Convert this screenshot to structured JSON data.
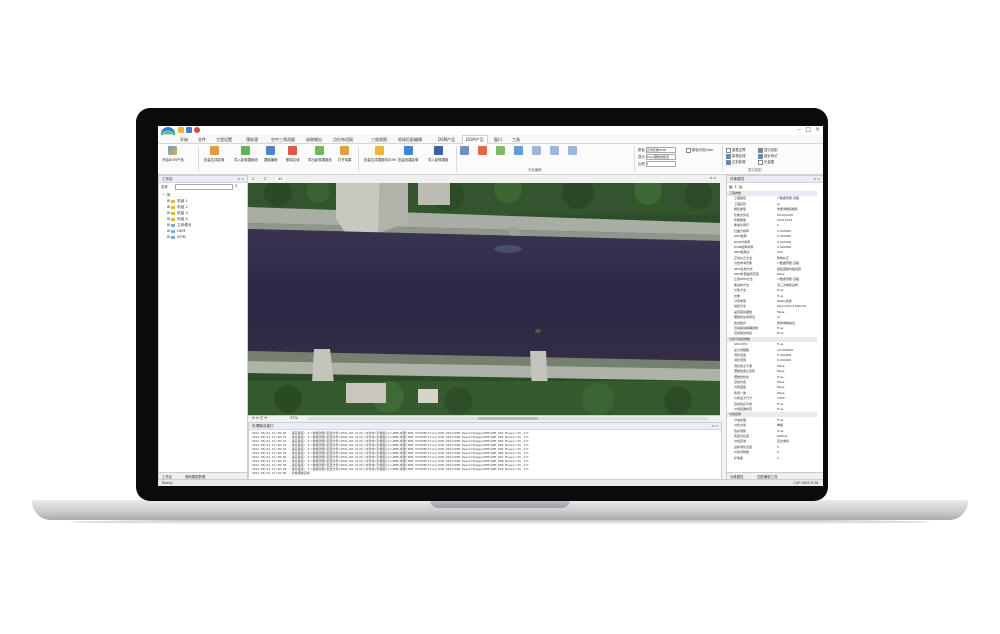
{
  "app": {
    "menu": [
      "开始",
      "文件",
      "工程设置",
      "预处理",
      "空中三角测量",
      "成果输出",
      "点位布设报",
      "三维视图",
      "地球匹配编辑",
      "DSM产品",
      "DOM产品",
      "窗口",
      "工具"
    ],
    "active_menu": "DOM产品"
  },
  "ribbon": {
    "buttons": [
      "开始DOM产品",
      "批量生成影像",
      "导入影像镶嵌线",
      "镶嵌编辑",
      "删除区域",
      "导出影像镶嵌线",
      "打开成果",
      "批量生成镶嵌线DOM",
      "批量创建影像",
      "导入影像镶嵌",
      "",
      "",
      "",
      "",
      "",
      "",
      ""
    ],
    "group_label": "匀色编辑",
    "group_label2": "显示控制",
    "options": {
      "color_label": "颜色",
      "color_value": "正射影像DOM",
      "blend_label": "显示",
      "blend_value": "Tiled镶嵌线配置",
      "scale_label": "比例",
      "scale_value": "1",
      "checks": [
        "颜色匀色Sdm",
        "显示控制",
        "重叠边界",
        "影像区域",
        "指针标记",
        "正射影像",
        "矢量图"
      ]
    },
    "check_states": [
      false,
      false,
      true,
      true,
      true,
      true,
      false
    ]
  },
  "project_panel": {
    "title": "工作区",
    "search_label": "名称",
    "tree": [
      "一 测",
      "机组 1",
      "机组 2",
      "机组 3",
      "机组 4",
      "立体像对",
      "DEM",
      "DOM"
    ],
    "tabs": [
      "工作区",
      "倾斜模型数据"
    ]
  },
  "map": {
    "tabs": [
      "1",
      "2",
      "40"
    ],
    "zoom": "37%"
  },
  "log": {
    "title": "处理输出窗口",
    "lines": [
      "2021-08-01 13:38:40 - 保存路径: I:\\数据测量\\配置文件\\2021-08-21(0)\\文件夹\\影像图(1)\\DOM\\成果\\DOM_V3\\DOM\\Tiled_DOM_2021\\DOM_ResultImage\\DOM\\DOM_001_Mosaic(0).tif",
      "2021-08-01 13:38:41 - 保存路径: I:\\数据测量\\配置文件\\2021-08-21(0)\\文件夹\\影像图(1)\\DOM\\成果\\DOM_V3\\DOM\\Tiled_DOM_2021\\DOM_ResultImage\\DOM\\DOM_002_Mosaic(0).tif",
      "2021-08-01 13:38:42 - 保存路径: I:\\数据测量\\配置文件\\2021-08-21(0)\\文件夹\\影像图(1)\\DOM\\成果\\DOM_V3\\DOM\\Tiled_DOM_2021\\DOM_ResultImage\\DOM\\DOM_003_Mosaic(0).tif",
      "2021-08-01 13:38:43 - 保存路径: I:\\数据测量\\配置文件\\2021-08-21(0)\\文件夹\\影像图(1)\\DOM\\成果\\DOM_V3\\DOM\\Tiled_DOM_2021\\DOM_ResultImage\\DOM\\DOM_004_Mosaic(0).tif",
      "2021-08-01 13:38:44 - 保存路径: I:\\数据测量\\配置文件\\2021-08-21(0)\\文件夹\\影像图(1)\\DOM\\成果\\DOM_V3\\DOM\\Tiled_DOM_2021\\DOM_ResultImage\\DOM\\DOM_005_Mosaic(0).tif",
      "2021-08-01 13:38:45 - 保存路径: I:\\数据测量\\配置文件\\2021-08-21(0)\\文件夹\\影像图(1)\\DOM\\成果\\DOM_V3\\DOM\\Tiled_DOM_2021\\DOM_ResultImage\\DOM\\DOM_006_Mosaic(0).tif",
      "2021-08-01 13:38:46 - 保存路径: I:\\数据测量\\配置文件\\2021-08-21(0)\\文件夹\\影像图(1)\\DOM\\成果\\DOM_V3\\DOM\\Tiled_DOM_2021\\DOM_ResultImage\\DOM\\DOM_007_Mosaic(0).tif",
      "2021-08-01 13:38:47 - 保存路径: I:\\数据测量\\配置文件\\2021-08-21(0)\\文件夹\\影像图(1)\\DOM\\成果\\DOM_V3\\DOM\\Tiled_DOM_2021\\DOM_ResultImage\\DOM\\DOM_008_Mosaic(0).tif",
      "2021-08-01 13:38:48 - 保存路径: I:\\数据测量\\配置文件\\2021-08-21(0)\\文件夹\\影像图(1)\\DOM\\成果\\DOM_V3\\DOM\\Tiled_DOM_2021\\DOM_ResultImage\\DOM\\DOM_009_Mosaic(0).tif",
      "2021-08-01 13:38:49 - 保存路径: I:\\数据测量\\配置文件\\2021-08-21(0)\\文件夹\\影像图(1)\\DOM\\成果\\DOM_V3\\DOM\\Tiled_DOM_2021\\DOM_ResultImage\\DOM\\DOM_010_Mosaic(0).tif",
      "2021-08-01 13:38:50 - 影像镶嵌完成"
    ]
  },
  "properties": {
    "title": "对象属性",
    "rows": [
      [
        "cat",
        "工程参数",
        ""
      ],
      [
        "row",
        "工程路径",
        "I:\\数据测量-远程"
      ],
      [
        "row",
        "工程名称",
        "ql"
      ],
      [
        "row",
        "相机类型",
        "非量测数码相机"
      ],
      [
        "row",
        "影像文件名",
        "DSC02000"
      ],
      [
        "row",
        "影像数量",
        "20211002"
      ],
      [
        "row",
        "像素比例尺",
        "0"
      ],
      [
        "row",
        "扫描分辨率",
        "0.003600"
      ],
      [
        "row",
        "DEM格网",
        "0.040000"
      ],
      [
        "row",
        "DOM分辨率",
        "0.040000"
      ],
      [
        "row",
        "DOM格网间隔",
        "0.040000"
      ],
      [
        "row",
        "DEM格网点",
        "200"
      ],
      [
        "row",
        "正射纠正方法",
        "整体纠正"
      ],
      [
        "row",
        "匀色参考影像",
        "I:\\数据测量-远程"
      ],
      [
        "row",
        "DEM生成方式",
        "加权函数内插运算"
      ],
      [
        "row",
        "DEM外部插值范围",
        "False"
      ],
      [
        "row",
        "正射DEM方法",
        "I:\\数据测量-远程"
      ],
      [
        "row",
        "重采样方法",
        "双三次卷积采样"
      ],
      [
        "row",
        "匀色方法",
        "True"
      ],
      [
        "row",
        "拉伸",
        "True"
      ],
      [
        "row",
        "分带类型",
        "Wallis滤波"
      ],
      [
        "row",
        "拼接方法",
        "Stand Point Method"
      ],
      [
        "row",
        "是否裁剪图幅",
        "False"
      ],
      [
        "row",
        "镶嵌线生成算法",
        "ql"
      ],
      [
        "row",
        "输出格式",
        "整体单独输出"
      ],
      [
        "row",
        "自动裁剪精确控制",
        "True"
      ],
      [
        "row",
        "自动裁剪拼接",
        "True"
      ],
      [
        "cat",
        "匀色与拼接参数",
        ""
      ],
      [
        "row",
        "GPU/CPU",
        "True"
      ],
      [
        "row",
        "最大线程数",
        "10.000000"
      ],
      [
        "row",
        "羽化宽度",
        "0.000000"
      ],
      [
        "row",
        "羽化范围",
        "0.000000"
      ],
      [
        "row",
        "羽化拐点平滑",
        "False"
      ],
      [
        "row",
        "镶嵌线避让建筑",
        "False"
      ],
      [
        "row",
        "镶嵌线优化",
        "True"
      ],
      [
        "row",
        "自动匀色",
        "False"
      ],
      [
        "row",
        "匀色强度",
        "False"
      ],
      [
        "row",
        "色调一致",
        "False"
      ],
      [
        "row",
        "匀色最大尺寸",
        "2400"
      ],
      [
        "row",
        "自动色彩平衡",
        "True"
      ],
      [
        "row",
        "匀色结果检查",
        "True"
      ],
      [
        "cat",
        "匀色控制",
        ""
      ],
      [
        "row",
        "分块处理",
        "True"
      ],
      [
        "row",
        "匀色方案",
        "单幅"
      ],
      [
        "row",
        "色彩调整",
        "True"
      ],
      [
        "row",
        "亮度对比度",
        "RADIAL"
      ],
      [
        "row",
        "匀色区域",
        "完全重叠"
      ],
      [
        "row",
        "边缘羽化宽度",
        "1"
      ],
      [
        "row",
        "匀色调整数",
        "0"
      ],
      [
        "row",
        "标准差",
        "0"
      ]
    ],
    "tabs": [
      "对象属性",
      "匹配编辑工具"
    ]
  },
  "statusbar": {
    "left": "Ready",
    "right": "CAP NUM SCRL"
  },
  "colors": {
    "water": "#312c4a",
    "grass": "#2f5a2a",
    "ribbon_bg": "#fbfbfb",
    "panel_header": "#e9eef5",
    "bezel": "#0b0b0d"
  }
}
